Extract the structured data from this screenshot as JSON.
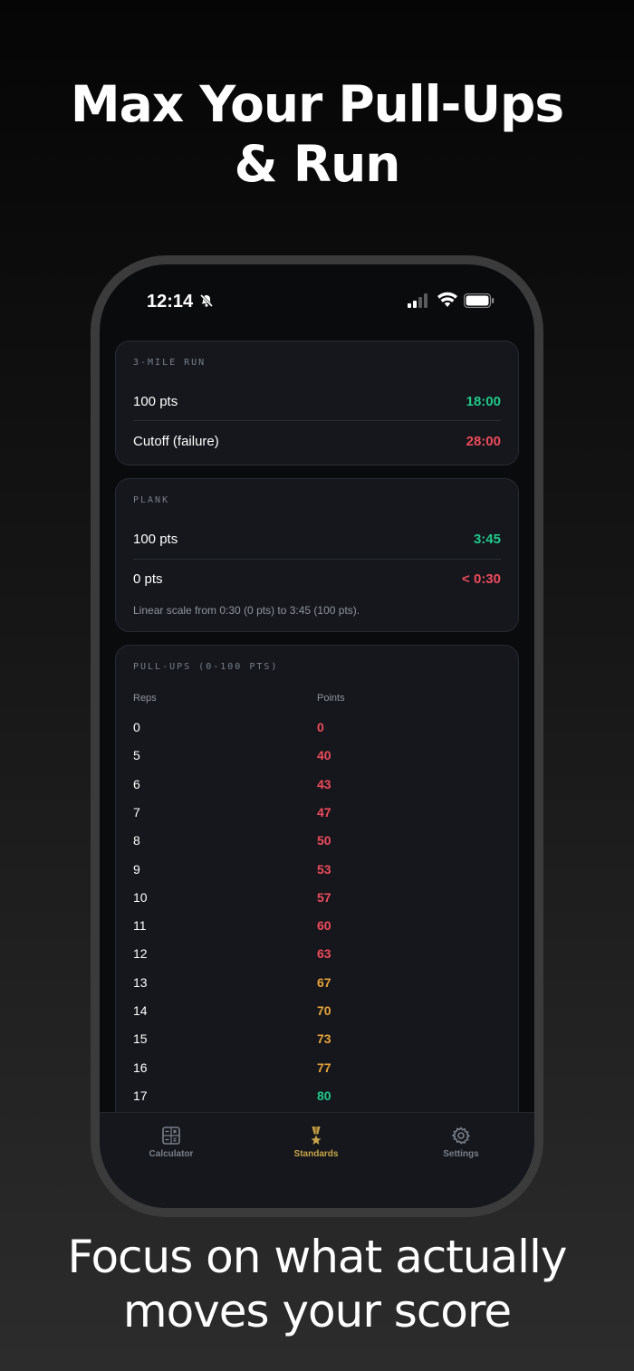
{
  "headline": {
    "line1": "Max Your Pull-Ups",
    "line2": "& Run"
  },
  "status_bar": {
    "time": "12:14"
  },
  "run_card": {
    "title": "3-MILE RUN",
    "rows": [
      {
        "label": "100 pts",
        "value": "18:00"
      },
      {
        "label": "Cutoff (failure)",
        "value": "28:00"
      }
    ]
  },
  "plank_card": {
    "title": "PLANK",
    "rows": [
      {
        "label": "100 pts",
        "value": "3:45"
      },
      {
        "label": "0 pts",
        "value": "< 0:30"
      }
    ],
    "note": "Linear scale from 0:30 (0 pts) to 3:45 (100 pts)."
  },
  "pullups_card": {
    "title": "PULL-UPS (0-100 PTS)",
    "col_reps": "Reps",
    "col_points": "Points",
    "rows": [
      {
        "reps": "0",
        "points": "0",
        "tier": "red"
      },
      {
        "reps": "5",
        "points": "40",
        "tier": "red"
      },
      {
        "reps": "6",
        "points": "43",
        "tier": "red"
      },
      {
        "reps": "7",
        "points": "47",
        "tier": "red"
      },
      {
        "reps": "8",
        "points": "50",
        "tier": "red"
      },
      {
        "reps": "9",
        "points": "53",
        "tier": "red"
      },
      {
        "reps": "10",
        "points": "57",
        "tier": "red"
      },
      {
        "reps": "11",
        "points": "60",
        "tier": "red"
      },
      {
        "reps": "12",
        "points": "63",
        "tier": "red"
      },
      {
        "reps": "13",
        "points": "67",
        "tier": "amber"
      },
      {
        "reps": "14",
        "points": "70",
        "tier": "amber"
      },
      {
        "reps": "15",
        "points": "73",
        "tier": "amber"
      },
      {
        "reps": "16",
        "points": "77",
        "tier": "amber"
      },
      {
        "reps": "17",
        "points": "80",
        "tier": "green"
      }
    ]
  },
  "tabs": [
    {
      "label": "Calculator",
      "icon": "calculator-icon",
      "active": false
    },
    {
      "label": "Standards",
      "icon": "medal-icon",
      "active": true
    },
    {
      "label": "Settings",
      "icon": "gear-icon",
      "active": false
    }
  ],
  "colors": {
    "green": "#1fc98a",
    "red": "#ef4b5c",
    "amber": "#e8a33a",
    "gold": "#c9a44a"
  },
  "caption": {
    "line1": "Focus on what actually",
    "line2": "moves your score"
  }
}
